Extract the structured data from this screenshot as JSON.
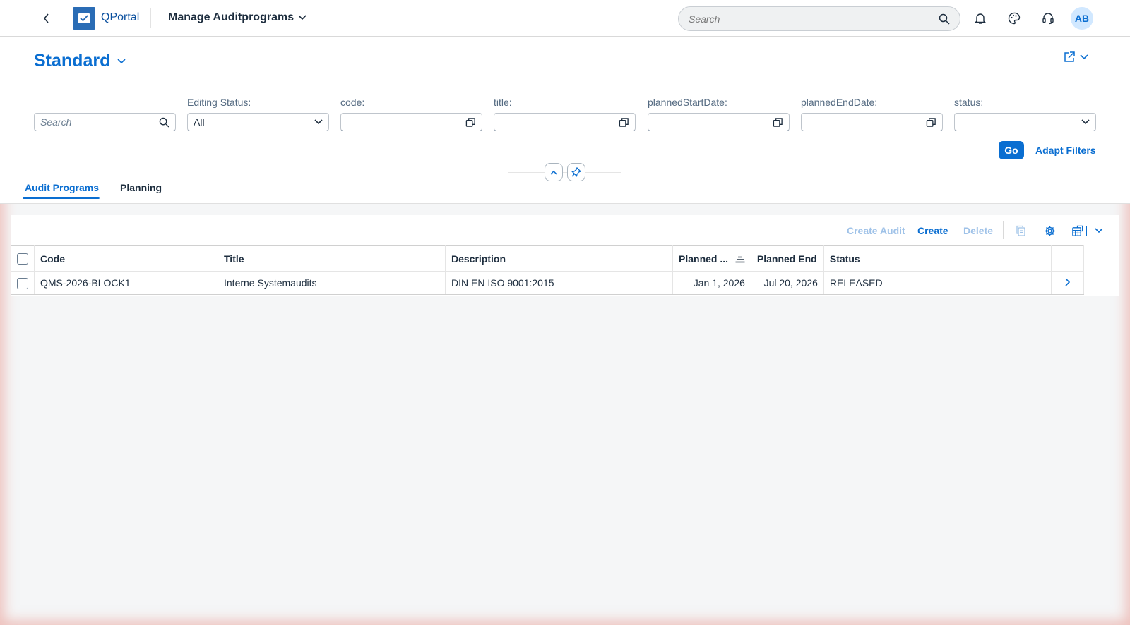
{
  "shell": {
    "product_name": "QPortal",
    "app_title": "Manage Auditprograms",
    "search_placeholder": "Search",
    "avatar_initials": "AB"
  },
  "header": {
    "variant_name": "Standard"
  },
  "filters": {
    "search_placeholder": "Search",
    "editing_status": {
      "label": "Editing Status:",
      "value": "All"
    },
    "code": {
      "label": "code:",
      "value": ""
    },
    "title": {
      "label": "title:",
      "value": ""
    },
    "planned_start": {
      "label": "plannedStartDate:",
      "value": ""
    },
    "planned_end": {
      "label": "plannedEndDate:",
      "value": ""
    },
    "status": {
      "label": "status:",
      "value": ""
    },
    "go_label": "Go",
    "adapt_label": "Adapt Filters"
  },
  "tabs": [
    {
      "label": "Audit Programs",
      "active": true
    },
    {
      "label": "Planning",
      "active": false
    }
  ],
  "toolbar": {
    "create_audit": "Create Audit",
    "create": "Create",
    "delete": "Delete"
  },
  "table": {
    "columns": [
      "Code",
      "Title",
      "Description",
      "Planned ...",
      "Planned End",
      "Status"
    ],
    "rows": [
      {
        "code": "QMS-2026-BLOCK1",
        "title": "Interne Systemaudits",
        "description": "DIN EN ISO 9001:2015",
        "planned_start": "Jan 1, 2026",
        "planned_end": "Jul 20, 2026",
        "status": "RELEASED"
      }
    ]
  },
  "colors": {
    "accent": "#0a6ed1",
    "disabled_accent": "#9fc2e8",
    "logo": "#2a6cb5"
  }
}
